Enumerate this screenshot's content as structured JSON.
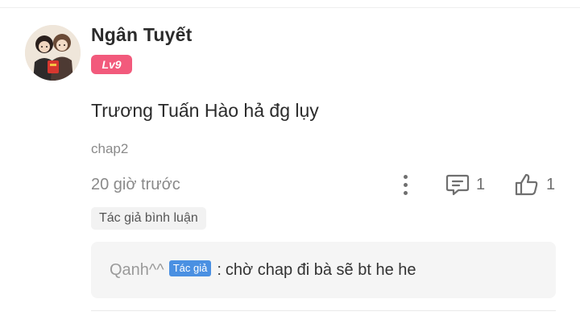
{
  "comment": {
    "username": "Ngân Tuyết",
    "level": "Lv9",
    "text": "Trương Tuấn Hào hả đg lụy",
    "chapter": "chap2",
    "timestamp": "20 giờ trước",
    "reply_count": "1",
    "like_count": "1",
    "author_comment_tag": "Tác giả bình luận"
  },
  "reply": {
    "user": "Qanh^^",
    "badge": "Tác giả",
    "separator": ":",
    "text": "chờ chap đi bà sẽ bt he he"
  },
  "icons": {
    "more": "more-vertical-icon",
    "reply": "comment-icon",
    "like": "thumbs-up-icon"
  },
  "colors": {
    "level_badge": "#f25a7c",
    "author_badge": "#4a90e2",
    "secondary_text": "#8a8a8a"
  }
}
